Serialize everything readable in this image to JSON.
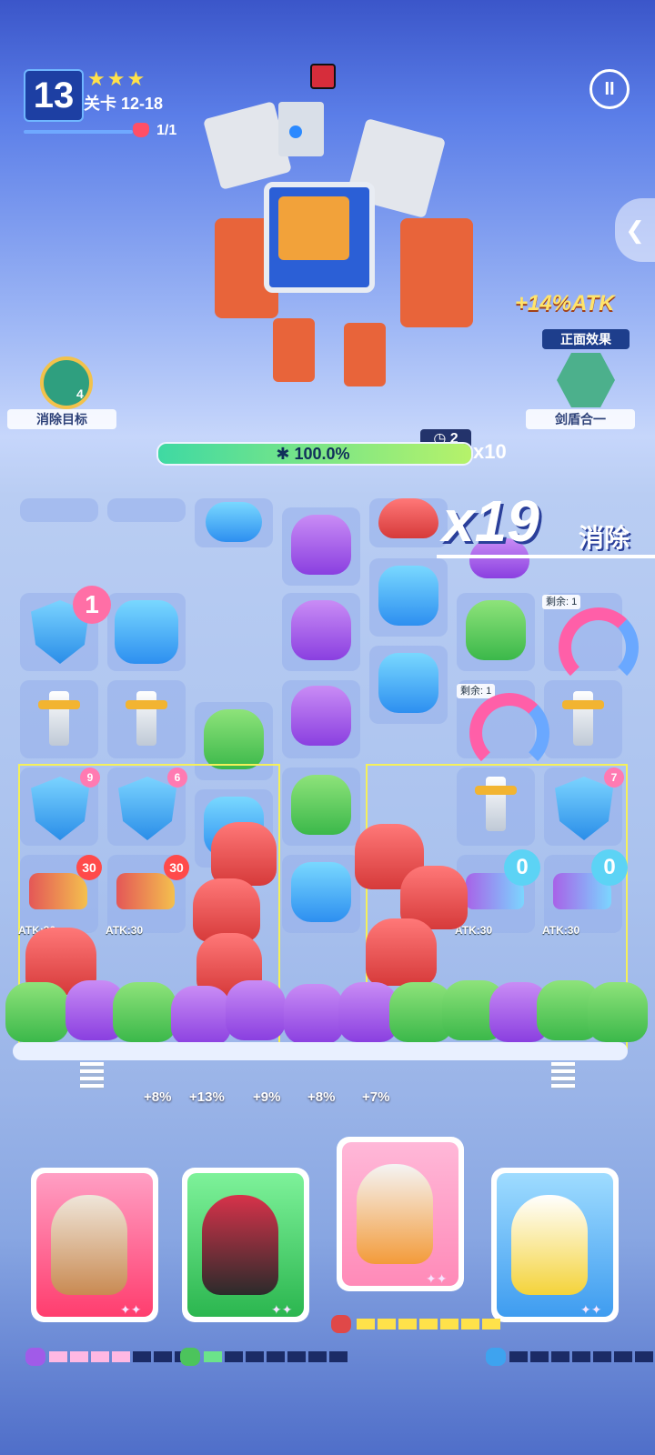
{
  "hud": {
    "level_number": "13",
    "stage_label": "关卡 12-18",
    "stars": "★★★",
    "boss_progress": "1/1",
    "pause_icon": "pause-icon",
    "side_tab_icon": "chevron-left-icon"
  },
  "boss": {
    "flag_icon": "boss-flag-icon"
  },
  "targets": {
    "left_badge_count": "4",
    "left_label": "消除目标",
    "atk_bonus": "+14%ATK",
    "effect_title": "正面效果",
    "right_label": "剑盾合一"
  },
  "progress": {
    "timer": "2",
    "percent_text": "100.0%",
    "percent_value": 1.0,
    "multiplier": "x10"
  },
  "combo": {
    "count": "x19",
    "label": "消除"
  },
  "board": {
    "heart_counter": "1",
    "remain_label_1": "剩余: 1",
    "remain_label_2": "剩余: 1",
    "shield_counters": [
      "9",
      "6",
      "7"
    ],
    "gun_counters": [
      "30",
      "30"
    ],
    "gun_atk": [
      "ATK:30",
      "ATK:30",
      "ATK:30",
      "ATK:30"
    ],
    "cyan_counters": [
      "0",
      "0"
    ]
  },
  "bonuses": [
    "+8%",
    "+13%",
    "+9%",
    "+8%",
    "+7%"
  ],
  "heroes": [
    {
      "name": "hero-caveman",
      "energy_on": 4,
      "energy_total": 7,
      "energy_color": "pink"
    },
    {
      "name": "hero-opera",
      "energy_on": 1,
      "energy_total": 7,
      "energy_color": "green"
    },
    {
      "name": "hero-astronaut-girl",
      "energy_on": 7,
      "energy_total": 7,
      "energy_color": "yellow"
    },
    {
      "name": "hero-bear",
      "energy_on": 0,
      "energy_total": 7,
      "energy_color": "blue"
    }
  ],
  "colors": {
    "accent": "#3fd9a3",
    "combo_shadow": "#2a3f9a",
    "atk_bonus": "#ffe46b"
  }
}
